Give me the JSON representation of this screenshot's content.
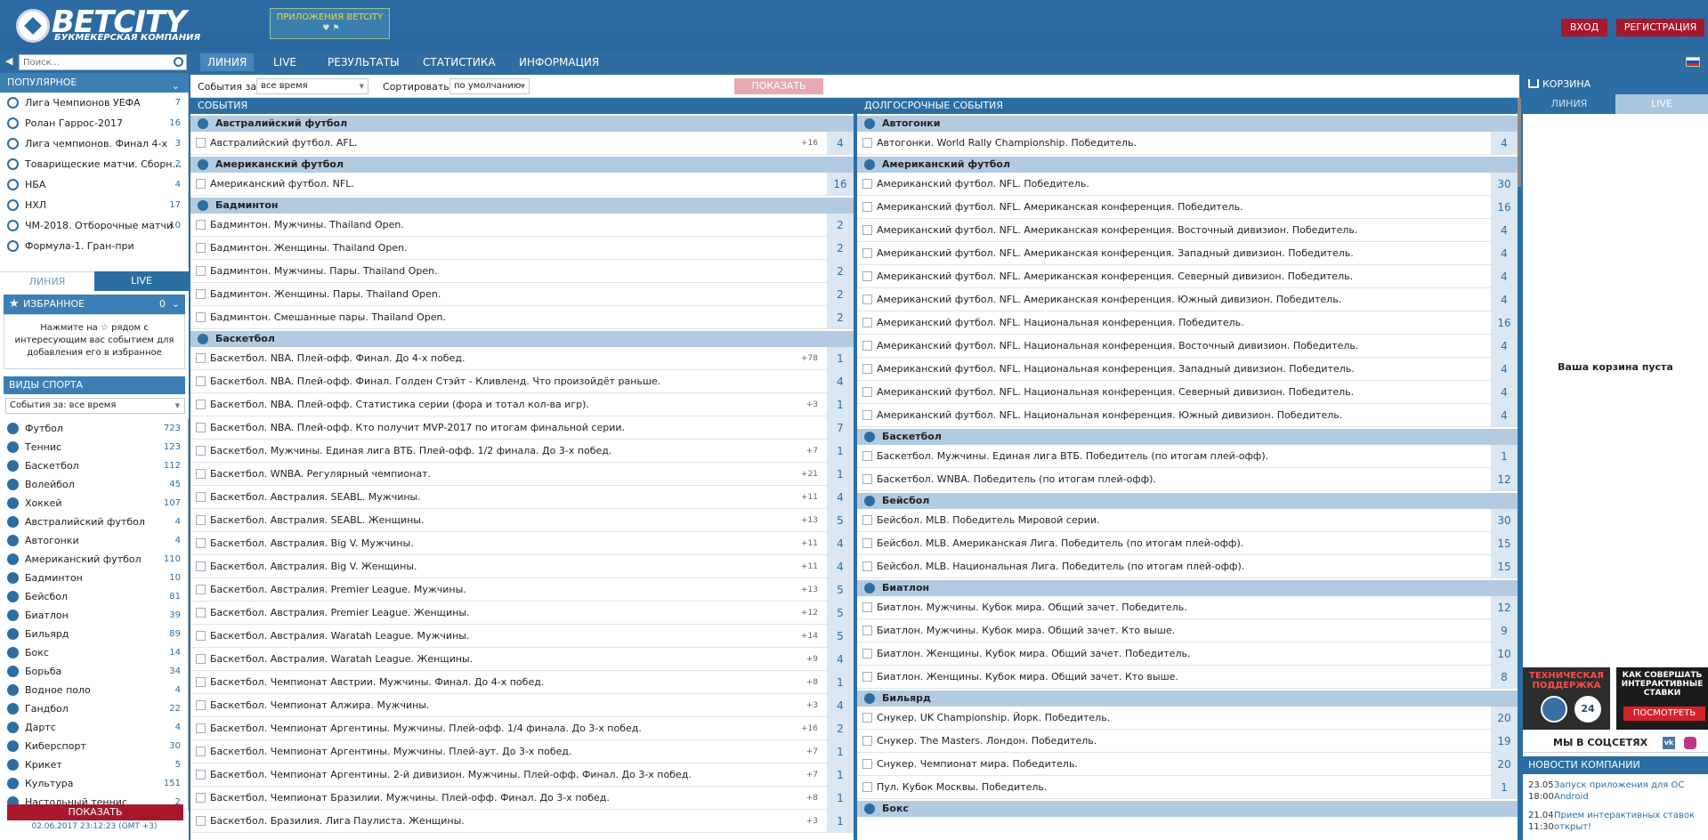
{
  "header": {
    "brand": "BETCITY",
    "tagline": "БУКМЕКЕРСКАЯ КОМПАНИЯ",
    "apps_label": "ПРИЛОЖЕНИЯ BETCITY",
    "apps_icons": " ♥ ⚑",
    "login": "ВХОД",
    "register": "РЕГИСТРАЦИЯ"
  },
  "nav": {
    "search_placeholder": "Поиск...",
    "items": [
      "ЛИНИЯ",
      "LIVE",
      "РЕЗУЛЬТАТЫ",
      "СТАТИСТИКА",
      "ИНФОРМАЦИЯ"
    ]
  },
  "popular": {
    "title": "ПОПУЛЯРНОЕ",
    "items": [
      {
        "label": "Лига Чемпионов УЕФА",
        "count": "7"
      },
      {
        "label": "Ролан Гаррос-2017",
        "count": "16"
      },
      {
        "label": "Лига чемпионов. Финал 4-х",
        "count": "3"
      },
      {
        "label": "Товарищеские матчи. Сборн...",
        "count": "2"
      },
      {
        "label": "НБА",
        "count": "4"
      },
      {
        "label": "НХЛ",
        "count": "17"
      },
      {
        "label": "ЧМ-2018. Отборочные матчи",
        "count": "10"
      },
      {
        "label": "Формула-1. Гран-при",
        "count": ""
      }
    ]
  },
  "left_tabs": {
    "line": "ЛИНИЯ",
    "live": "LIVE"
  },
  "favorites": {
    "title": "ИЗБРАННОЕ",
    "count": "0",
    "hint_a": "Нажмите на",
    "hint_b": "рядом с интересующим вас событием для добавления его в избранное"
  },
  "sports": {
    "title": "ВИДЫ СПОРТА",
    "period": "События за: все время",
    "items": [
      {
        "label": "Футбол",
        "count": "723"
      },
      {
        "label": "Теннис",
        "count": "123"
      },
      {
        "label": "Баскетбол",
        "count": "112"
      },
      {
        "label": "Волейбол",
        "count": "45"
      },
      {
        "label": "Хоккей",
        "count": "107"
      },
      {
        "label": "Австралийский футбол",
        "count": "4"
      },
      {
        "label": "Автогонки",
        "count": "4"
      },
      {
        "label": "Американский футбол",
        "count": "110"
      },
      {
        "label": "Бадминтон",
        "count": "10"
      },
      {
        "label": "Бейсбол",
        "count": "81"
      },
      {
        "label": "Биатлон",
        "count": "39"
      },
      {
        "label": "Бильярд",
        "count": "89"
      },
      {
        "label": "Бокс",
        "count": "14"
      },
      {
        "label": "Борьба",
        "count": "34"
      },
      {
        "label": "Водное поло",
        "count": "4"
      },
      {
        "label": "Гандбол",
        "count": "22"
      },
      {
        "label": "Дартс",
        "count": "4"
      },
      {
        "label": "Киберспорт",
        "count": "30"
      },
      {
        "label": "Крикет",
        "count": "5"
      },
      {
        "label": "Культура",
        "count": "151"
      },
      {
        "label": "Настольный теннис",
        "count": "2"
      }
    ],
    "show_button": "ПОКАЗАТЬ",
    "datetime": "02.06.2017 23:12:23  (GMT +3)"
  },
  "filters": {
    "period_label": "События за:",
    "period_value": "все время",
    "sort_label": "Сортировать:",
    "sort_value": "по умолчанию",
    "show_button": "ПОКАЗАТЬ"
  },
  "events": {
    "title": "СОБЫТИЯ",
    "groups": [
      {
        "name": "Австралийский футбол",
        "rows": [
          {
            "name": "Австралийский футбол. AFL.",
            "plus": "+16",
            "count": "4"
          }
        ]
      },
      {
        "name": "Американский футбол",
        "rows": [
          {
            "name": "Американский футбол. NFL.",
            "plus": "",
            "count": "16"
          }
        ]
      },
      {
        "name": "Бадминтон",
        "rows": [
          {
            "name": "Бадминтон. Мужчины. Thailand Open.",
            "plus": "",
            "count": "2"
          },
          {
            "name": "Бадминтон. Женщины. Thailand Open.",
            "plus": "",
            "count": "2"
          },
          {
            "name": "Бадминтон. Мужчины. Пары. Thailand Open.",
            "plus": "",
            "count": "2"
          },
          {
            "name": "Бадминтон. Женщины. Пары. Thailand Open.",
            "plus": "",
            "count": "2"
          },
          {
            "name": "Бадминтон. Смешанные пары. Thailand Open.",
            "plus": "",
            "count": "2"
          }
        ]
      },
      {
        "name": "Баскетбол",
        "rows": [
          {
            "name": "Баскетбол. NBA. Плей-офф. Финал. До 4-х побед.",
            "plus": "+78",
            "count": "1"
          },
          {
            "name": "Баскетбол. NBA. Плей-офф. Финал. Голден Стэйт - Кливленд. Что произойдёт раньше.",
            "plus": "",
            "count": "4"
          },
          {
            "name": "Баскетбол. NBA. Плей-офф. Статистика серии (фора и тотал кол-ва игр).",
            "plus": "+3",
            "count": "1"
          },
          {
            "name": "Баскетбол. NBA. Плей-офф. Кто получит MVP-2017 по итогам финальной серии.",
            "plus": "",
            "count": "7"
          },
          {
            "name": "Баскетбол. Мужчины. Единая лига ВТБ. Плей-офф. 1/2 финала. До 3-х побед.",
            "plus": "+7",
            "count": "1"
          },
          {
            "name": "Баскетбол. WNBA. Регулярный чемпионат.",
            "plus": "+21",
            "count": "1"
          },
          {
            "name": "Баскетбол. Австралия. SEABL. Мужчины.",
            "plus": "+11",
            "count": "4"
          },
          {
            "name": "Баскетбол. Австралия. SEABL. Женщины.",
            "plus": "+13",
            "count": "5"
          },
          {
            "name": "Баскетбол. Австралия. Big V. Мужчины.",
            "plus": "+11",
            "count": "4"
          },
          {
            "name": "Баскетбол. Австралия. Big V. Женщины.",
            "plus": "+11",
            "count": "4"
          },
          {
            "name": "Баскетбол. Австралия. Premier League. Мужчины.",
            "plus": "+13",
            "count": "5"
          },
          {
            "name": "Баскетбол. Австралия. Premier League. Женщины.",
            "plus": "+12",
            "count": "5"
          },
          {
            "name": "Баскетбол. Австралия. Waratah League. Мужчины.",
            "plus": "+14",
            "count": "5"
          },
          {
            "name": "Баскетбол. Австралия. Waratah League. Женщины.",
            "plus": "+9",
            "count": "4"
          },
          {
            "name": "Баскетбол. Чемпионат Австрии. Мужчины. Финал. До 4-х побед.",
            "plus": "+8",
            "count": "1"
          },
          {
            "name": "Баскетбол. Чемпионат Алжира. Мужчины.",
            "plus": "+3",
            "count": "4"
          },
          {
            "name": "Баскетбол. Чемпионат Аргентины. Мужчины. Плей-офф. 1/4 финала. До 3-х побед.",
            "plus": "+16",
            "count": "2"
          },
          {
            "name": "Баскетбол. Чемпионат Аргентины. Мужчины. Плей-аут. До 3-х побед.",
            "plus": "+7",
            "count": "1"
          },
          {
            "name": "Баскетбол. Чемпионат Аргентины. 2-й дивизион. Мужчины. Плей-офф. Финал. До 3-х побед.",
            "plus": "+7",
            "count": "1"
          },
          {
            "name": "Баскетбол. Чемпионат Бразилии. Мужчины. Плей-офф. Финал. До 3-х побед.",
            "plus": "+8",
            "count": "1"
          },
          {
            "name": "Баскетбол. Бразилия. Лига Паулиста. Женщины.",
            "plus": "+3",
            "count": "1"
          }
        ]
      }
    ]
  },
  "longterm": {
    "title": "ДОЛГОСРОЧНЫЕ СОБЫТИЯ",
    "groups": [
      {
        "name": "Автогонки",
        "rows": [
          {
            "name": "Автогонки. World Rally Championship. Победитель.",
            "count": "4"
          }
        ]
      },
      {
        "name": "Американский футбол",
        "rows": [
          {
            "name": "Американский футбол. NFL. Победитель.",
            "count": "30"
          },
          {
            "name": "Американский футбол. NFL. Американская конференция. Победитель.",
            "count": "16"
          },
          {
            "name": "Американский футбол. NFL. Американская конференция. Восточный дивизион. Победитель.",
            "count": "4"
          },
          {
            "name": "Американский футбол. NFL. Американская конференция. Западный дивизион. Победитель.",
            "count": "4"
          },
          {
            "name": "Американский футбол. NFL. Американская конференция. Северный дивизион. Победитель.",
            "count": "4"
          },
          {
            "name": "Американский футбол. NFL. Американская конференция. Южный дивизион. Победитель.",
            "count": "4"
          },
          {
            "name": "Американский футбол. NFL. Национальная конференция. Победитель.",
            "count": "16"
          },
          {
            "name": "Американский футбол. NFL. Национальная конференция. Восточный дивизион. Победитель.",
            "count": "4"
          },
          {
            "name": "Американский футбол. NFL. Национальная конференция. Западный дивизион. Победитель.",
            "count": "4"
          },
          {
            "name": "Американский футбол. NFL. Национальная конференция. Северный дивизион. Победитель.",
            "count": "4"
          },
          {
            "name": "Американский футбол. NFL. Национальная конференция. Южный дивизион. Победитель.",
            "count": "4"
          }
        ]
      },
      {
        "name": "Баскетбол",
        "rows": [
          {
            "name": "Баскетбол. Мужчины. Единая лига ВТБ. Победитель (по итогам плей-офф).",
            "count": "1"
          },
          {
            "name": "Баскетбол. WNBA. Победитель (по итогам плей-офф).",
            "count": "12"
          }
        ]
      },
      {
        "name": "Бейсбол",
        "rows": [
          {
            "name": "Бейсбол. MLB. Победитель Мировой серии.",
            "count": "30"
          },
          {
            "name": "Бейсбол. MLB. Американская Лига. Победитель (по итогам плей-офф).",
            "count": "15"
          },
          {
            "name": "Бейсбол. MLB. Национальная Лига. Победитель (по итогам плей-офф).",
            "count": "15"
          }
        ]
      },
      {
        "name": "Биатлон",
        "rows": [
          {
            "name": "Биатлон. Мужчины. Кубок мира. Общий зачет. Победитель.",
            "count": "12"
          },
          {
            "name": "Биатлон. Мужчины. Кубок мира. Общий зачет. Кто выше.",
            "count": "9"
          },
          {
            "name": "Биатлон. Женщины. Кубок мира. Общий зачет. Победитель.",
            "count": "10"
          },
          {
            "name": "Биатлон. Женщины. Кубок мира. Общий зачет. Кто выше.",
            "count": "8"
          }
        ]
      },
      {
        "name": "Бильярд",
        "rows": [
          {
            "name": "Снукер. UK Championship. Йорк. Победитель.",
            "count": "20"
          },
          {
            "name": "Снукер. The Masters. Лондон. Победитель.",
            "count": "19"
          },
          {
            "name": "Снукер. Чемпионат мира. Победитель.",
            "count": "20"
          },
          {
            "name": "Пул. Кубок Москвы. Победитель.",
            "count": "1"
          }
        ]
      },
      {
        "name": "Бокс",
        "rows": []
      }
    ]
  },
  "cart": {
    "title": "КОРЗИНА",
    "tab_line": "ЛИНИЯ",
    "tab_live": "LIVE",
    "empty": "Ваша корзина пуста"
  },
  "banners": {
    "support": "ТЕХНИЧЕСКАЯ ПОДДЕРЖКА",
    "support_badge": "24",
    "interactive": "КАК СОВЕРШАТЬ ИНТЕРАКТИВНЫЕ СТАВКИ",
    "watch": "ПОСМОТРЕТЬ"
  },
  "social": {
    "title": "МЫ В СОЦСЕТЯХ",
    "vk": "vk"
  },
  "news": {
    "title": "НОВОСТИ КОМПАНИИ",
    "items": [
      {
        "date": "23.05",
        "time": "18:00",
        "text": "Запуск приложения для ОС Android"
      },
      {
        "date": "21.04",
        "time": "11:30",
        "text": "Прием интерактивных ставок открыт!"
      }
    ]
  },
  "colors": {
    "primary": "#2b6ea3",
    "accent_red": "#a7182d",
    "group_bg": "#b3cbe0",
    "count_bg": "#dbe7f3"
  }
}
